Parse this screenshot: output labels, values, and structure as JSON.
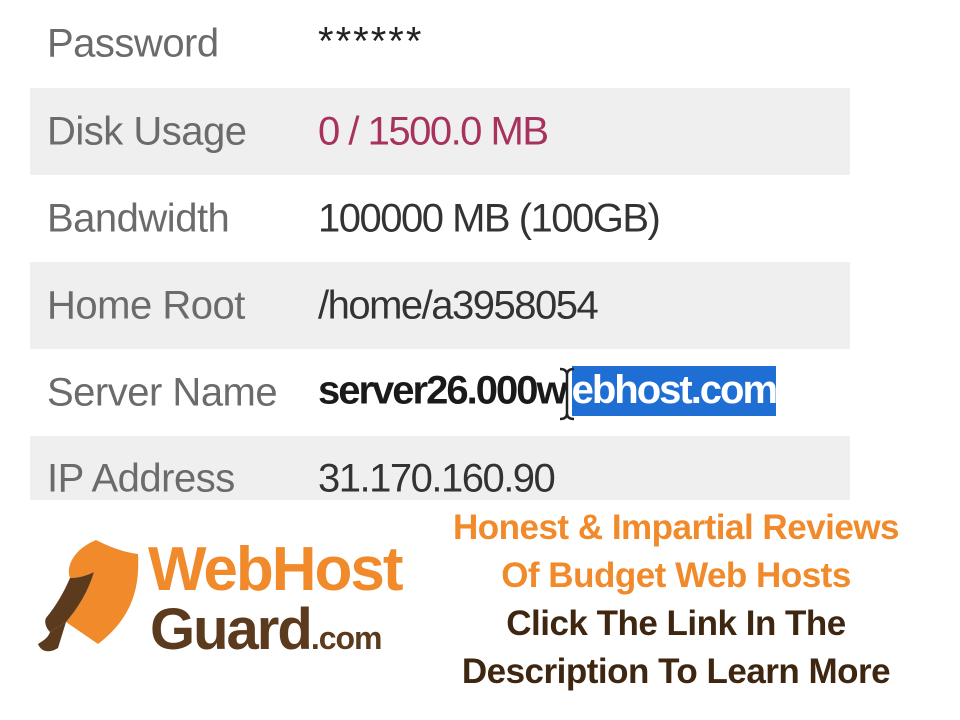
{
  "account_details": {
    "rows": [
      {
        "label": "Password",
        "value": "******"
      },
      {
        "label": "Disk Usage",
        "value": "0 / 1500.0 MB"
      },
      {
        "label": "Bandwidth",
        "value": "100000 MB (100GB)"
      },
      {
        "label": "Home Root",
        "value": "/home/a3958054"
      },
      {
        "label": "Server Name",
        "value_unselected": "server26.000w",
        "value_selected": "ebhost.com"
      },
      {
        "label": "IP Address",
        "value": "31.170.160.90"
      }
    ]
  },
  "colors": {
    "row_shade": "#efefef",
    "label": "#6b6b6b",
    "disk_usage_value": "#a8325e",
    "selection": "#1f6ed4",
    "brand_orange": "#f08a2a",
    "brand_brown": "#5b3a1e"
  },
  "banner": {
    "logo_top": "WebHost",
    "logo_bottom": "Guard",
    "logo_suffix": ".com",
    "line1": "Honest & Impartial Reviews",
    "line2": "Of Budget Web Hosts",
    "line3": "Click The Link In The",
    "line4": "Description To Learn More",
    "icon": "shield-icon"
  },
  "cursor": {
    "icon": "text-cursor-icon"
  }
}
